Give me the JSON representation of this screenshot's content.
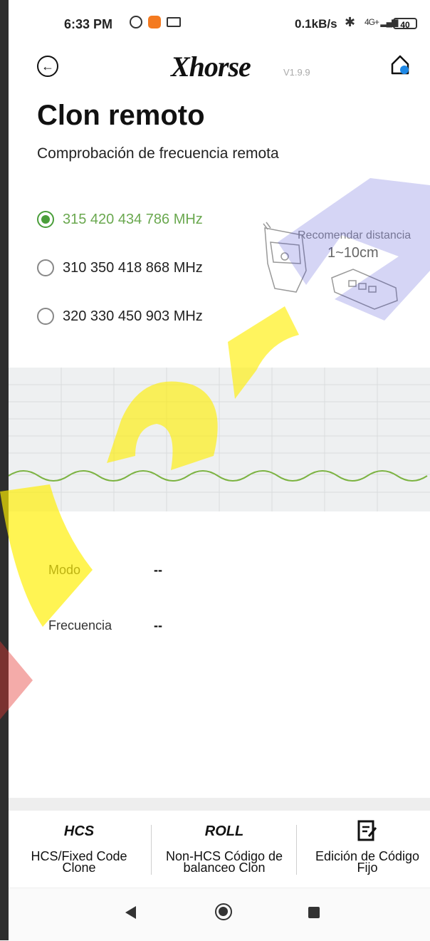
{
  "status_bar": {
    "time": "6:33 PM",
    "speed": "0.1kB/s",
    "signal": "4G+",
    "battery": "40"
  },
  "header": {
    "logo": "Xhorse",
    "version": "V1.9.9"
  },
  "page": {
    "title": "Clon remoto",
    "subtitle": "Comprobación de frecuencia remota"
  },
  "frequency_options": [
    {
      "label": "315 420 434 786 MHz",
      "selected": true
    },
    {
      "label": "310 350 418 868 MHz",
      "selected": false
    },
    {
      "label": "320 330 450 903 MHz",
      "selected": false
    }
  ],
  "illustration": {
    "recommend_label": "Recomendar distancia",
    "distance": "1~10cm"
  },
  "info": {
    "mode_label": "Modo",
    "mode_value": "--",
    "frequency_label": "Frecuencia",
    "frequency_value": "--"
  },
  "bottom_tabs": [
    {
      "icon": "HCS",
      "label_line1": "HCS/Fixed Code",
      "label_line2": "Clone"
    },
    {
      "icon": "ROLL",
      "label_line1": "Non-HCS Código de",
      "label_line2": "balanceo Clon"
    },
    {
      "icon": "edit-icon",
      "label_line1": "Edición de Código",
      "label_line2": "Fijo"
    }
  ],
  "colors": {
    "accent_green": "#4a9e3a",
    "watermark_yellow": "#ffee00",
    "watermark_blue": "#3a3ad0"
  }
}
